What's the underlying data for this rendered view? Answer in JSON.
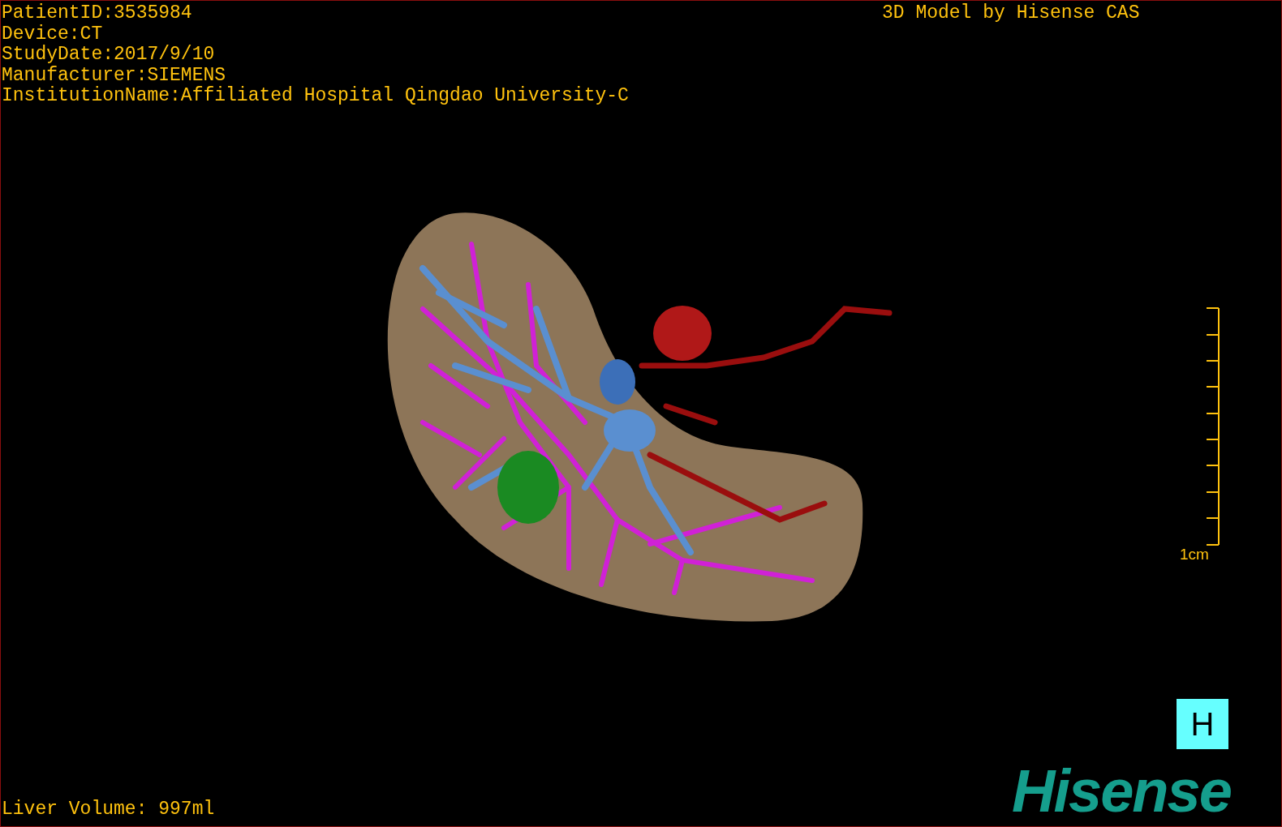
{
  "study_info": [
    "PatientID:3535984",
    "Device:CT",
    "StudyDate:2017/9/10",
    "Manufacturer:SIEMENS",
    "InstitutionName:Affiliated Hospital Qingdao University-C"
  ],
  "model_credit": "3D Model by Hisense CAS",
  "scale_bar": {
    "label": "1cm"
  },
  "orientation_marker": "H",
  "logo": "Hisense",
  "liver_volume": "Liver Volume: 997ml"
}
